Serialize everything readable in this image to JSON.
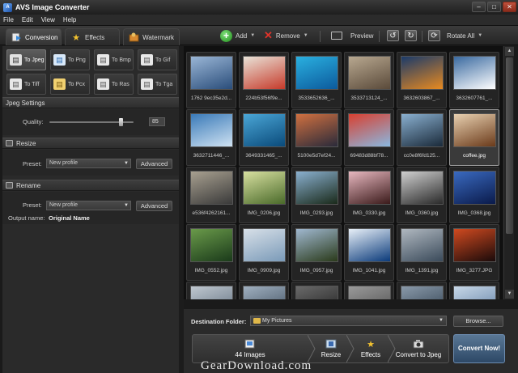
{
  "window": {
    "title": "AVS Image Converter",
    "minimize": "–",
    "maximize": "□",
    "close": "✕"
  },
  "menu": [
    "File",
    "Edit",
    "View",
    "Help"
  ],
  "tabs": [
    {
      "label": "Conversion",
      "icon": "conversion-icon"
    },
    {
      "label": "Effects",
      "icon": "star-icon"
    },
    {
      "label": "Watermark",
      "icon": "watermark-icon"
    }
  ],
  "toolbar": {
    "add": "Add",
    "remove": "Remove",
    "preview": "Preview",
    "rotate_all": "Rotate All"
  },
  "formats": [
    "To Jpeg",
    "To Png",
    "To Bmp",
    "To Gif",
    "To Tiff",
    "To Pcx",
    "To Ras",
    "To Tga"
  ],
  "jpeg_settings": {
    "title": "Jpeg Settings",
    "quality_label": "Quality:",
    "quality_value": "85",
    "quality_fraction": 0.85
  },
  "resize": {
    "title": "Resize",
    "preset_label": "Preset:",
    "preset_value": "New profile",
    "advanced": "Advanced"
  },
  "rename": {
    "title": "Rename",
    "preset_label": "Preset:",
    "preset_value": "New profile",
    "advanced": "Advanced",
    "output_label": "Output name:",
    "output_value": "Original Name"
  },
  "gallery": {
    "items": [
      {
        "name": "1762 9ec35e2d...",
        "colors": [
          "#2a4d7a",
          "#9ab6d6"
        ]
      },
      {
        "name": "224b53f56f9e...",
        "colors": [
          "#c63a2a",
          "#e9e3d8"
        ]
      },
      {
        "name": "3533652636_...",
        "colors": [
          "#0c5a9c",
          "#2ab0e0"
        ]
      },
      {
        "name": "3533713124_...",
        "colors": [
          "#5a4a3a",
          "#b8a890"
        ]
      },
      {
        "name": "3632603867_...",
        "colors": [
          "#e88a20",
          "#1a3a6a"
        ]
      },
      {
        "name": "3632607761_...",
        "colors": [
          "#ffffff",
          "#3a6aa0"
        ]
      },
      {
        "name": "3632711446_...",
        "colors": [
          "#cfe2f2",
          "#3a7ab8"
        ]
      },
      {
        "name": "3649331465_...",
        "colors": [
          "#0a4a7a",
          "#4aa6d6"
        ]
      },
      {
        "name": "5100e5d7ef24...",
        "colors": [
          "#2a2a3a",
          "#d07040"
        ]
      },
      {
        "name": "69483d88bf78...",
        "colors": [
          "#8ab8e0",
          "#d84030"
        ]
      },
      {
        "name": "cc0e8f6fd125...",
        "colors": [
          "#1a2a3a",
          "#8ab0d0"
        ]
      },
      {
        "name": "coffee.jpg",
        "colors": [
          "#6a3a1a",
          "#e8d0b0"
        ]
      },
      {
        "name": "e536f4262161...",
        "colors": [
          "#3a3a3a",
          "#a8a090"
        ]
      },
      {
        "name": "IMG_0206.jpg",
        "colors": [
          "#4a6a2a",
          "#d8e0a0"
        ]
      },
      {
        "name": "IMG_0293.jpg",
        "colors": [
          "#1a2a1a",
          "#8ab0d0"
        ]
      },
      {
        "name": "IMG_0330.jpg",
        "colors": [
          "#3a1a1a",
          "#e8b8c0"
        ]
      },
      {
        "name": "IMG_0360.jpg",
        "colors": [
          "#2a2a2a",
          "#d0d0d0"
        ]
      },
      {
        "name": "IMG_0368.jpg",
        "colors": [
          "#0a1a4a",
          "#3a6ac0"
        ]
      },
      {
        "name": "IMG_0552.jpg",
        "colors": [
          "#1a3a1a",
          "#6a9a4a"
        ]
      },
      {
        "name": "IMG_0909.jpg",
        "colors": [
          "#7a9ab8",
          "#d8e0e8"
        ]
      },
      {
        "name": "IMG_0957.jpg",
        "colors": [
          "#2a3a1a",
          "#a0b8d0"
        ]
      },
      {
        "name": "IMG_1041.jpg",
        "colors": [
          "#0a3a7a",
          "#e8f0f8"
        ]
      },
      {
        "name": "IMG_1391.jpg",
        "colors": [
          "#3a4a5a",
          "#b0b8c0"
        ]
      },
      {
        "name": "IMG_3277.JPG",
        "colors": [
          "#1a0a0a",
          "#d04a20"
        ]
      },
      {
        "name": "",
        "colors": [
          "#5a6a7a",
          "#c0c8d0"
        ]
      },
      {
        "name": "",
        "colors": [
          "#3a4a5a",
          "#a0b0c0"
        ]
      },
      {
        "name": "",
        "colors": [
          "#1a1a1a",
          "#6a6a6a"
        ]
      },
      {
        "name": "",
        "colors": [
          "#4a4a4a",
          "#9a9a9a"
        ]
      },
      {
        "name": "",
        "colors": [
          "#2a3a4a",
          "#8a9aaa"
        ]
      },
      {
        "name": "",
        "colors": [
          "#5a7aa0",
          "#c8d8e8"
        ]
      }
    ]
  },
  "destination": {
    "label": "Destination Folder:",
    "value": "My Pictures",
    "browse": "Browse..."
  },
  "steps": {
    "images": "44 Images",
    "resize": "Resize",
    "effects": "Effects",
    "convert_to": "Convert to Jpeg"
  },
  "convert_now": "Convert Now!",
  "watermark_text": "GearDownload.com"
}
